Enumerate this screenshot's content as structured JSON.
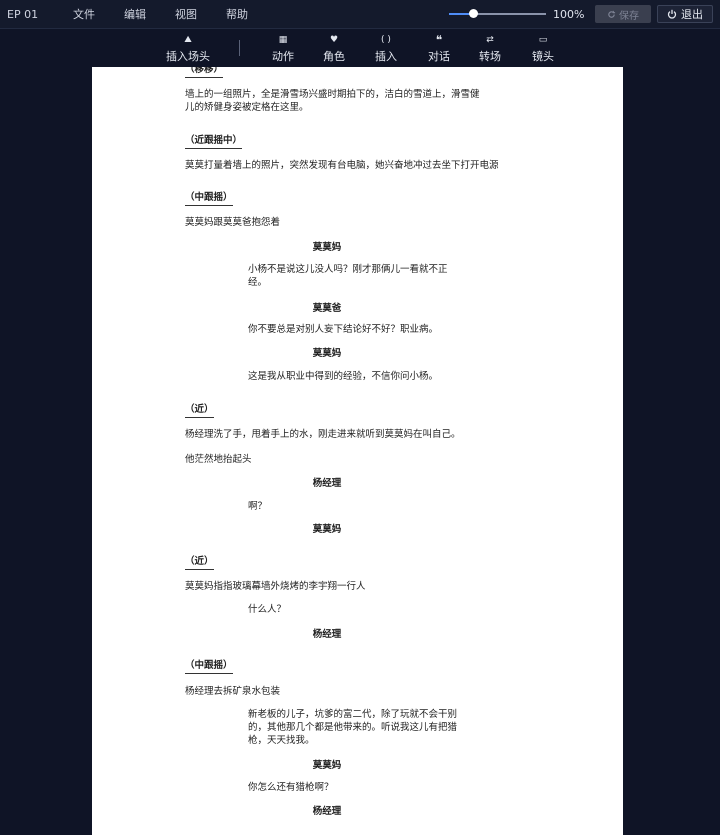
{
  "menubar": {
    "episode": "EP 01",
    "menus": [
      "文件",
      "编辑",
      "视图",
      "帮助"
    ],
    "zoom": {
      "value_label": "100%",
      "level": 0.25
    },
    "save_label": "保存",
    "exit_label": "退出"
  },
  "toolbar": {
    "scene": {
      "label": "插入场头",
      "icon": "scene-icon"
    },
    "action": {
      "label": "动作",
      "icon": "action-icon"
    },
    "character": {
      "label": "角色",
      "icon": "character-icon"
    },
    "insert": {
      "label": "插入",
      "icon": "parentheses-icon"
    },
    "dialogue": {
      "label": "对话",
      "icon": "quote-icon"
    },
    "transition": {
      "label": "转场",
      "icon": "transition-icon"
    },
    "shot": {
      "label": "镜头",
      "icon": "camera-icon"
    }
  },
  "script": {
    "scene_0": "（移移）",
    "action_0": "墙上的一组照片，全是滑雪场兴盛时期拍下的，洁白的雪道上，滑雪健儿的矫健身姿被定格在这里。",
    "scene_1": "（近跟摇中）",
    "action_1": "莫莫打量着墙上的照片，突然发现有台电脑，她兴奋地冲过去坐下打开电源",
    "scene_2": "（中跟摇）",
    "action_2": "莫莫妈跟莫莫爸抱怨着",
    "char_0": "莫莫妈",
    "dial_0": "小杨不是说这儿没人吗？刚才那俩儿一看就不正经。",
    "char_1": "莫莫爸",
    "dial_1": "你不要总是对别人妄下结论好不好？职业病。",
    "char_2": "莫莫妈",
    "dial_2": "这是我从职业中得到的经验，不信你问小杨。",
    "scene_3": "（近）",
    "action_3": "杨经理洗了手，甩着手上的水，刚走进来就听到莫莫妈在叫自己。",
    "action_4": "他茫然地抬起头",
    "char_3": "杨经理",
    "dial_3": "啊？",
    "char_4": "莫莫妈",
    "scene_4": "（近）",
    "action_5": "莫莫妈指指玻璃幕墙外烧烤的李宇翔一行人",
    "dial_4": "什么人？",
    "char_5": "杨经理",
    "scene_5": "（中跟摇）",
    "action_6": "杨经理去拆矿泉水包装",
    "dial_5": "新老板的儿子，坑爹的富二代，除了玩就不会干别的，其他那几个都是他带来的。听说我这儿有把猎枪，天天找我。",
    "char_6": "莫莫妈",
    "dial_6": "你怎么还有猎枪啊？",
    "char_7": "杨经理"
  }
}
